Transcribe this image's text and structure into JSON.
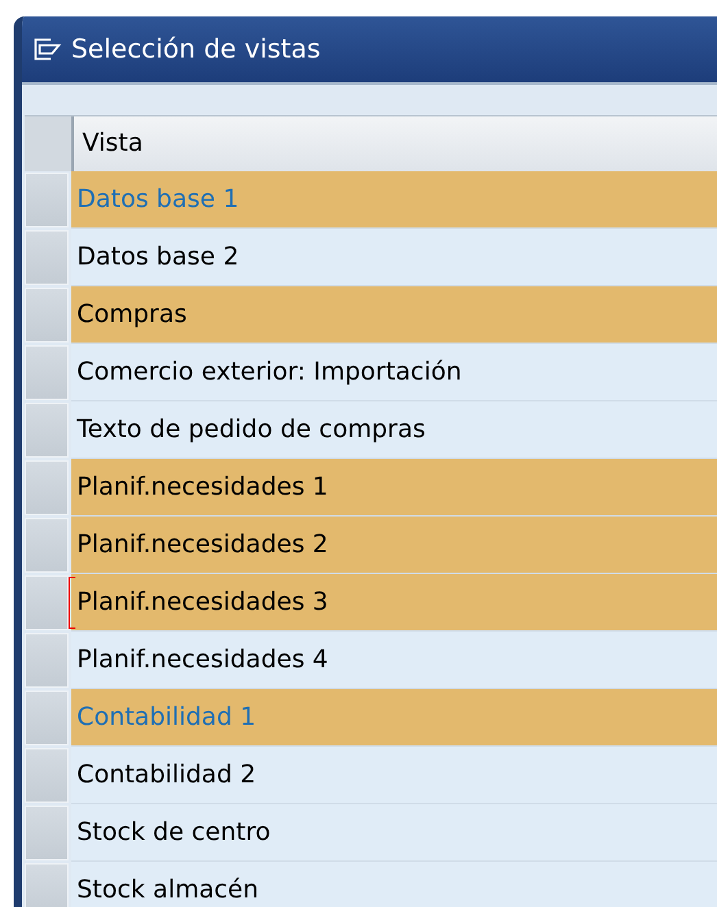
{
  "window": {
    "title": "Selección de vistas"
  },
  "table": {
    "columns": [
      "Vista"
    ],
    "rows": [
      {
        "label": "Datos base 1",
        "selected": true,
        "emphasized": true,
        "focused": false
      },
      {
        "label": "Datos base 2",
        "selected": false,
        "emphasized": false,
        "focused": false
      },
      {
        "label": "Compras",
        "selected": true,
        "emphasized": false,
        "focused": false
      },
      {
        "label": "Comercio exterior: Importación",
        "selected": false,
        "emphasized": false,
        "focused": false
      },
      {
        "label": "Texto de pedido de compras",
        "selected": false,
        "emphasized": false,
        "focused": false
      },
      {
        "label": "Planif.necesidades 1",
        "selected": true,
        "emphasized": false,
        "focused": false
      },
      {
        "label": "Planif.necesidades 2",
        "selected": true,
        "emphasized": false,
        "focused": false
      },
      {
        "label": "Planif.necesidades 3",
        "selected": true,
        "emphasized": false,
        "focused": true
      },
      {
        "label": "Planif.necesidades 4",
        "selected": false,
        "emphasized": false,
        "focused": false
      },
      {
        "label": "Contabilidad 1",
        "selected": true,
        "emphasized": true,
        "focused": false
      },
      {
        "label": "Contabilidad 2",
        "selected": false,
        "emphasized": false,
        "focused": false
      },
      {
        "label": "Stock de centro",
        "selected": false,
        "emphasized": false,
        "focused": false
      },
      {
        "label": "Stock almacén",
        "selected": false,
        "emphasized": false,
        "focused": false
      }
    ]
  }
}
